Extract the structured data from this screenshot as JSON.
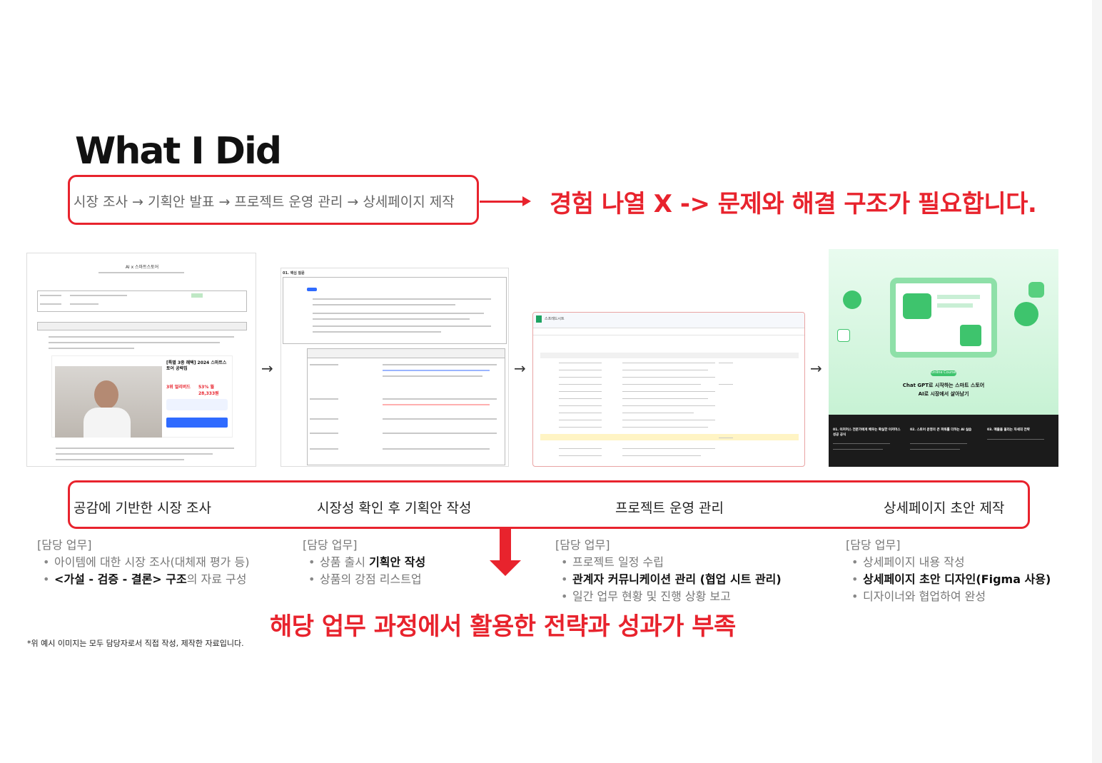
{
  "title": "What I Did",
  "flow": {
    "text": "시장 조사 → 기획안 발표 → 프로젝트 운영 관리 → 상세페이지 제작"
  },
  "headline": "경험 나열 X -> 문제와 해결 구조가 필요합니다.",
  "thumbnails": {
    "doc1": {
      "title": "AI x 스마트스토어",
      "card_title": "[특별 3종 혜택] 2024 스마트스토어 공략집",
      "badge": "3위 얼리버드",
      "price": "53% 월 28,333원"
    },
    "doc2": {
      "section": "01. 핵심 질문"
    },
    "sheet": {
      "caption": "스프레드시트"
    },
    "design": {
      "tag": "Online Course",
      "line1": "Chat GPT로 시작하는 스마트 스토어",
      "line2": "AI로 시장에서 살아남기",
      "col1": "01. 이커머스 전문가에게 배우는 확실한 이커머스 성공 공식",
      "col2": "02. 스토어 운영의 큰 파워를 더하는 AI 실습",
      "col3": "03. 매출을 올리는 차세대 전략"
    }
  },
  "arrow": "→",
  "steps": [
    "공감에 기반한 시장 조사",
    "시장성 확인 후 기획안 작성",
    "프로젝트 운영 관리",
    "상세페이지 초안 제작"
  ],
  "duties": [
    {
      "header": "[담당 업무]",
      "items": [
        {
          "pre": "아이템에 대한 시장 조사(대체재 평가 등)",
          "bold": "",
          "post": ""
        },
        {
          "pre": "",
          "bold": "<가설 - 검증 - 결론> 구조",
          "post": "의 자료 구성"
        }
      ]
    },
    {
      "header": "[담당 업무]",
      "items": [
        {
          "pre": "상품 출시 ",
          "bold": "기획안 작성",
          "post": ""
        },
        {
          "pre": "상품의 강점 리스트업",
          "bold": "",
          "post": ""
        }
      ]
    },
    {
      "header": "[담당 업무]",
      "items": [
        {
          "pre": "프로젝트 일정 수립",
          "bold": "",
          "post": ""
        },
        {
          "pre": "",
          "bold": "관계자 커뮤니케이션 관리 (협업 시트 관리)",
          "post": ""
        },
        {
          "pre": "일간 업무 현황 및 진행 상황 보고",
          "bold": "",
          "post": ""
        }
      ]
    },
    {
      "header": "[담당 업무]",
      "items": [
        {
          "pre": "상세페이지 내용 작성",
          "bold": "",
          "post": ""
        },
        {
          "pre": "",
          "bold": "상세페이지 초안 디자인(Figma 사용)",
          "post": ""
        },
        {
          "pre": "디자이너와 협업하여 완성",
          "bold": "",
          "post": ""
        }
      ]
    }
  ],
  "bottom_message": "해당 업무 과정에서 활용한 전략과 성과가 부족",
  "footnote": "*위 예시 이미지는 모두 담당자로서 직접 작성, 제작한 자료입니다.",
  "colors": {
    "accent": "#e8232d",
    "green": "#3ec46d"
  }
}
